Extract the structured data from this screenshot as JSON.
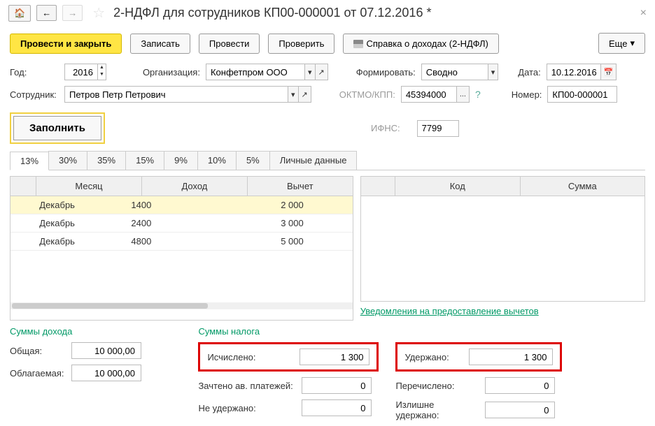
{
  "title": "2-НДФЛ для сотрудников КП00-000001 от 07.12.2016 *",
  "toolbar": {
    "post_close": "Провести и закрыть",
    "save": "Записать",
    "post": "Провести",
    "check": "Проверить",
    "print": "Справка о доходах (2-НДФЛ)",
    "more": "Еще"
  },
  "fields": {
    "year_label": "Год:",
    "year": "2016",
    "org_label": "Организация:",
    "org": "Конфетпром ООО",
    "form_label": "Формировать:",
    "form": "Сводно",
    "date_label": "Дата:",
    "date": "10.12.2016",
    "emp_label": "Сотрудник:",
    "emp": "Петров Петр Петрович",
    "oktmo_label": "ОКТМО/КПП:",
    "oktmo": "45394000",
    "number_label": "Номер:",
    "number": "КП00-000001",
    "ifns_label": "ИФНС:",
    "ifns": "7799"
  },
  "fill_btn": "Заполнить",
  "tabs": [
    "13%",
    "30%",
    "35%",
    "15%",
    "9%",
    "10%",
    "5%",
    "Личные данные"
  ],
  "left_headers": [
    "",
    "Месяц",
    "Доход",
    "Вычет"
  ],
  "left_rows": [
    {
      "m": "Декабрь",
      "income": "1400",
      "deduct": "2 000",
      "hl": true
    },
    {
      "m": "Декабрь",
      "income": "2400",
      "deduct": "3 000"
    },
    {
      "m": "Декабрь",
      "income": "4800",
      "deduct": "5 000"
    }
  ],
  "right_headers": [
    "Код",
    "Сумма"
  ],
  "link": "Уведомления на предоставление вычетов",
  "sums_income": {
    "title": "Суммы дохода",
    "total_label": "Общая:",
    "total": "10 000,00",
    "taxable_label": "Облагаемая:",
    "taxable": "10 000,00"
  },
  "sums_tax": {
    "title": "Суммы налога",
    "calc_label": "Исчислено:",
    "calc": "1 300",
    "offset_label": "Зачтено ав. платежей:",
    "offset": "0",
    "notwithheld_label": "Не удержано:",
    "notwithheld": "0",
    "withheld_label": "Удержано:",
    "withheld": "1 300",
    "transferred_label": "Перечислено:",
    "transferred": "0",
    "over_label": "Излишне удержано:",
    "over": "0"
  }
}
